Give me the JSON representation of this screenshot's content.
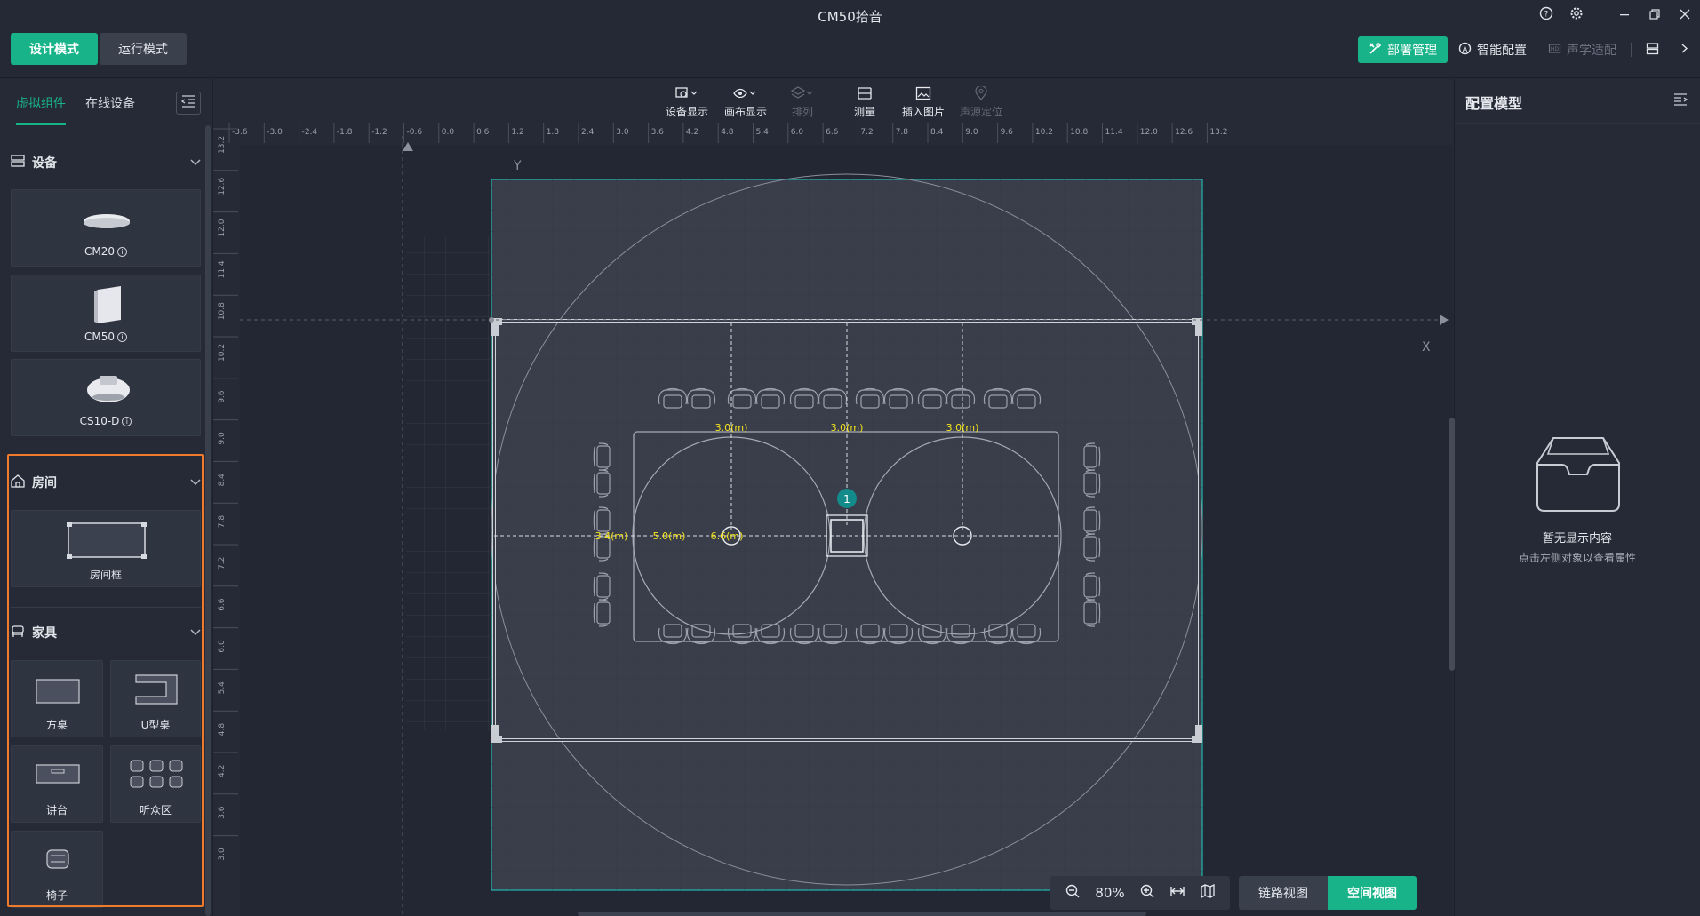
{
  "title_bar": {
    "title": "CM50拾音",
    "icons": [
      "help-icon",
      "settings-icon",
      "minimize-icon",
      "restore-icon",
      "close-icon"
    ]
  },
  "mode_bar": {
    "design_mode": "设计模式",
    "run_mode": "运行模式",
    "deploy": "部署管理",
    "smart_config": "智能配置",
    "acoustic_adapt": "声学适配"
  },
  "left_panel": {
    "tabs": [
      "虚拟组件",
      "在线设备"
    ],
    "sections": {
      "devices": {
        "title": "设备",
        "items": [
          "CM20",
          "CM50",
          "CS10-D"
        ]
      },
      "room": {
        "title": "房间",
        "items": [
          "房间框"
        ]
      },
      "furniture": {
        "title": "家具",
        "items": [
          "方桌",
          "U型桌",
          "讲台",
          "听众区",
          "椅子"
        ]
      }
    }
  },
  "toolbar": {
    "items": [
      "设备显示",
      "画布显示",
      "排列",
      "测量",
      "插入图片",
      "声源定位"
    ]
  },
  "canvas": {
    "ruler_x": [
      "-3.6",
      "-3.0",
      "-2.4",
      "-1.8",
      "-1.2",
      "-0.6",
      "0.0",
      "0.6",
      "1.2",
      "1.8",
      "2.4",
      "3.0",
      "3.6",
      "4.2",
      "4.8",
      "5.4",
      "6.0",
      "6.6",
      "7.2",
      "7.8",
      "8.4",
      "9.0",
      "9.6",
      "10.2",
      "10.8",
      "11.4",
      "12.0",
      "12.6",
      "13.2"
    ],
    "ruler_y": [
      "13.2",
      "12.6",
      "12.0",
      "11.4",
      "10.8",
      "10.2",
      "9.6",
      "9.0",
      "8.4",
      "7.8",
      "7.2",
      "6.6",
      "6.0",
      "5.4",
      "4.8",
      "4.2",
      "3.6",
      "3.0"
    ],
    "axis_y": "Y",
    "axis_x": "X",
    "labels_top": [
      "3.0(m)",
      "3.0(m)",
      "3.0(m)"
    ],
    "labels_left": [
      "3.4(m)",
      "5.0(m)",
      "6.6(m)"
    ],
    "device_badge": "1"
  },
  "right_panel": {
    "title": "配置模型",
    "empty_title": "暂无显示内容",
    "empty_sub": "点击左侧对象以查看属性"
  },
  "bottom_bar": {
    "zoom": "80%",
    "link_view": "链路视图",
    "space_view": "空间视图"
  },
  "colors": {
    "accent": "#19b38a",
    "highlight": "#f07a2c",
    "measure": "#f5e51c"
  }
}
